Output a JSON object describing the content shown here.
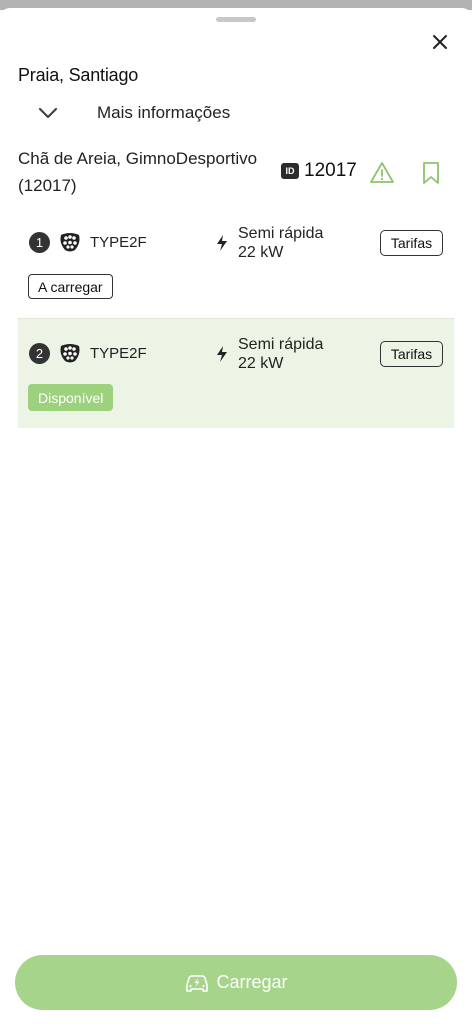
{
  "header": {
    "city": "Praia, Santiago",
    "more_info": "Mais informações"
  },
  "station": {
    "name": "Chã de Areia, GimnoDesportivo (12017)",
    "id_badge": "ID",
    "id": "12017"
  },
  "connectors": [
    {
      "number": "1",
      "type": "TYPE2F",
      "speed_label": "Semi rápida",
      "power": "22 kW",
      "tariffs_label": "Tarifas",
      "status": "A carregar"
    },
    {
      "number": "2",
      "type": "TYPE2F",
      "speed_label": "Semi rápida",
      "power": "22 kW",
      "tariffs_label": "Tarifas",
      "status": "Disponível"
    }
  ],
  "footer": {
    "charge_label": "Carregar"
  },
  "colors": {
    "accent_green": "#a5d48a",
    "available_bg": "#ecf5e5",
    "available_badge": "#9dd17d",
    "icon_green": "#8cc46c"
  },
  "icons": {
    "close": "close-icon",
    "expand": "chevron-down-icon",
    "warning": "warning-icon",
    "bookmark": "bookmark-icon",
    "plug": "type2-plug-icon",
    "bolt": "lightning-bolt-icon",
    "car": "car-charge-icon"
  }
}
